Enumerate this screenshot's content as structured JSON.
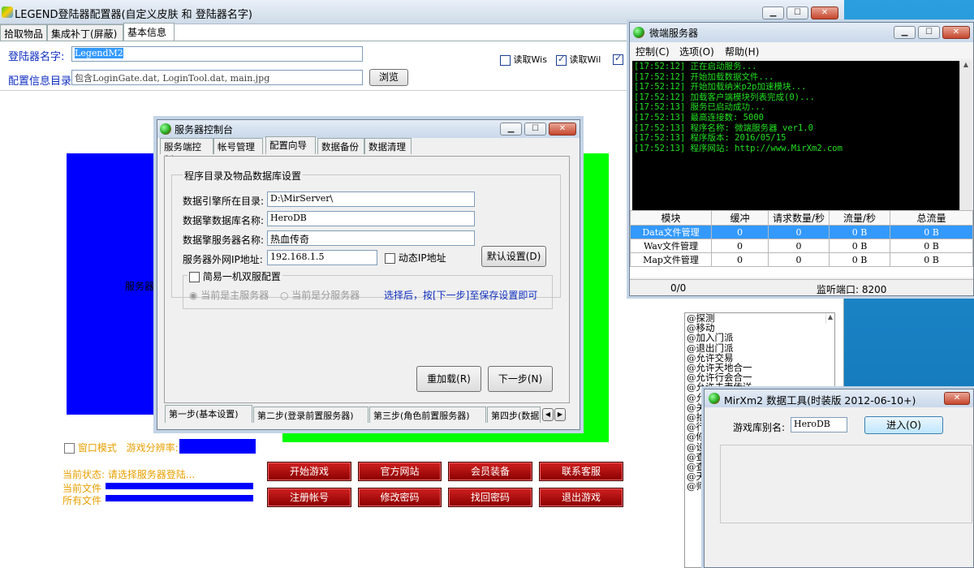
{
  "main": {
    "title": "LEGEND登陆器配置器(自定义皮肤 和 登陆器名字)",
    "tabs": [
      "拾取物品",
      "集成补丁(屏蔽)",
      "基本信息"
    ],
    "launcher_name_label": "登陆器名字:",
    "launcher_name_value": "LegendM2",
    "config_dir_label": "配置信息目录",
    "config_dir_value": "包含LoginGate.dat, LoginTool.dat, main.jpg",
    "browse_label": "浏览",
    "read_wis_label": "读取Wis",
    "read_wil_label": "读取Wil",
    "server_partial_text": "服务器",
    "window_mode_label": "窗口模式",
    "resolution_label": "游戏分辨率:",
    "status_text": "当前状态: 请选择服务器登陆...",
    "current_file_label": "当前文件",
    "all_files_label": "所有文件",
    "buttons": [
      "开始游戏",
      "官方网站",
      "会员装备",
      "联系客服",
      "注册帐号",
      "修改密码",
      "找回密码",
      "退出游戏"
    ],
    "commands": [
      "@探测",
      "@移动",
      "@加入门派",
      "@退出门派",
      "@允许交易",
      "@允许天地合一",
      "@允许行会合一",
      "@允许夫妻传送",
      "@允许",
      "@关",
      "@拾",
      "@行",
      "@修",
      "@设",
      "@查",
      "@查",
      "@天",
      "@师"
    ]
  },
  "console": {
    "title": "服务器控制台",
    "tabs": [
      "服务端控制",
      "帐号管理",
      "配置向导",
      "数据备份",
      "数据清理"
    ],
    "group_title": "程序目录及物品数据库设置",
    "fields": [
      {
        "label": "数据引擎所在目录:",
        "value": "D:\\MirServer\\"
      },
      {
        "label": "数据擎数据库名称:",
        "value": "HeroDB"
      },
      {
        "label": "数据擎服务器名称:",
        "value": "热血传奇"
      },
      {
        "label": "服务器外网IP地址:",
        "value": "192.168.1.5"
      }
    ],
    "dynamic_ip_label": "动态IP地址",
    "default_btn": "默认设置(D)",
    "dual_title": "简易一机双服配置",
    "radio_main": "当前是主服务器",
    "radio_sub": "当前是分服务器",
    "hint": "选择后，按[下一步]至保存设置即可",
    "reload_btn": "重加载(R)",
    "next_btn": "下一步(N)",
    "steps": [
      "第一步(基本设置)",
      "第二步(登录前置服务器)",
      "第三步(角色前置服务器)",
      "第四步(数据"
    ]
  },
  "micro": {
    "title": "微端服务器",
    "menu": [
      "控制(C)",
      "选项(O)",
      "帮助(H)"
    ],
    "log": [
      "[17:52:12] 正在启动服务...",
      "[17:52:12] 开始加载数据文件...",
      "[17:52:12] 开始加载纳米p2p加速模块...",
      "[17:52:12] 加载客户端模块列表完成(0)...",
      "[17:52:13] 服务已启动成功...",
      "[17:52:13] 最高连接数: 5000",
      "[17:52:13] 程序名称: 微端服务器 ver1.0",
      "[17:52:13] 程序版本: 2016/05/15",
      "[17:52:13] 程序网站: http://www.MirXm2.com"
    ],
    "headers": [
      "模块",
      "缓冲",
      "请求数量/秒",
      "流量/秒",
      "总流量"
    ],
    "rows": [
      [
        "Data文件管理",
        "0",
        "0",
        "0 B",
        "0 B"
      ],
      [
        "Wav文件管理",
        "0",
        "0",
        "0 B",
        "0 B"
      ],
      [
        "Map文件管理",
        "0",
        "0",
        "0 B",
        "0 B"
      ]
    ],
    "status_left": "0/0",
    "status_port": "监听端口: 8200"
  },
  "datatool": {
    "title": "MirXm2 数据工具(时装版 2012-06-10+)",
    "alias_label": "游戏库别名:",
    "alias_value": "HeroDB",
    "enter_btn": "进入(O)"
  },
  "colors": {
    "log_text": "#22e022",
    "blue_panel": "#0000ff",
    "green_panel": "#00ff00",
    "status_orange": "#e8a000"
  }
}
